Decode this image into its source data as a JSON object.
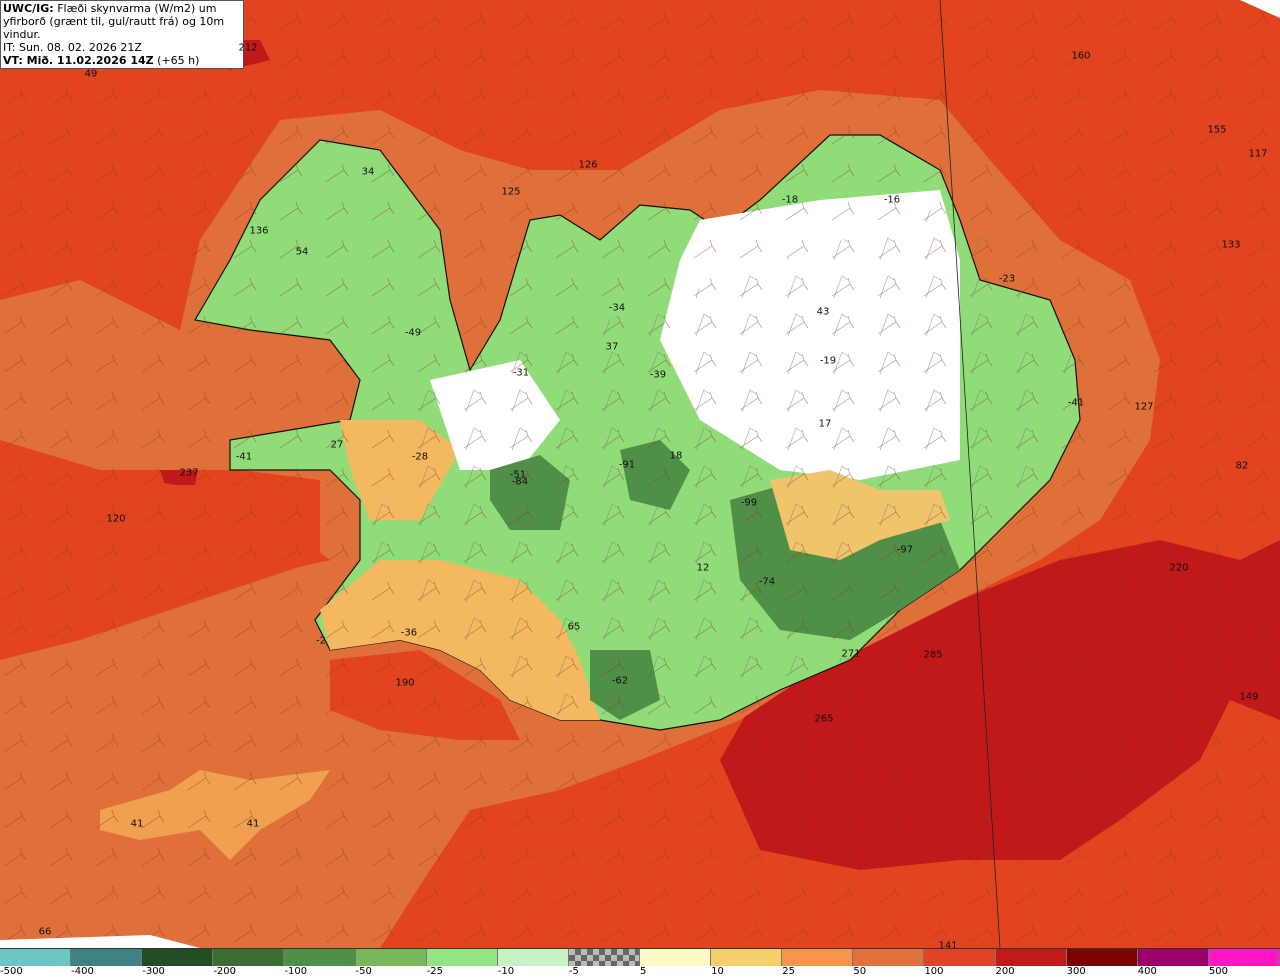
{
  "info": {
    "source_label": "UWC/IG:",
    "title_line1": "Flæði skynvarma (W/m2) um",
    "title_line2": "yfirborð (grænt til, gul/rautt frá) og 10m vindur.",
    "it_line": "IT: Sun. 08. 02. 2026 21Z",
    "vt_label": "VT: Mið. 11.02.2026 14Z",
    "vt_offset": "(+65 h)"
  },
  "map_labels": [
    "212",
    "49",
    "160",
    "155",
    "117",
    "126",
    "125",
    "34",
    "136",
    "54",
    "-18",
    "-16",
    "133",
    "-23",
    "43",
    "-34",
    "-49",
    "37",
    "-31",
    "-39",
    "-19",
    "-41",
    "127",
    "27",
    "237",
    "-41",
    "-28",
    "-51",
    "-84",
    "-91",
    "18",
    "17",
    "82",
    "120",
    "-99",
    "220",
    "12",
    "-74",
    "-97",
    "-2",
    "-36",
    "65",
    "271",
    "285",
    "190",
    "-62",
    "149",
    "265",
    "41",
    "41",
    "66",
    "141"
  ],
  "legend": {
    "ticks": [
      "-500",
      "-400",
      "-300",
      "-200",
      "-100",
      "-50",
      "-25",
      "-10",
      "-5",
      "5",
      "10",
      "25",
      "50",
      "100",
      "200",
      "300",
      "400",
      "500"
    ],
    "colors": [
      "#6cc6c3",
      "#3f8283",
      "#234d24",
      "#3b6e35",
      "#4f8f47",
      "#78b85a",
      "#92e57f",
      "#c6f3c3",
      "checker",
      "#fdfbc3",
      "#f4cf6a",
      "#fa944b",
      "#e0703e",
      "#e24423",
      "#c2191b",
      "#7c0000",
      "#9a0068",
      "#ff17c4"
    ]
  }
}
